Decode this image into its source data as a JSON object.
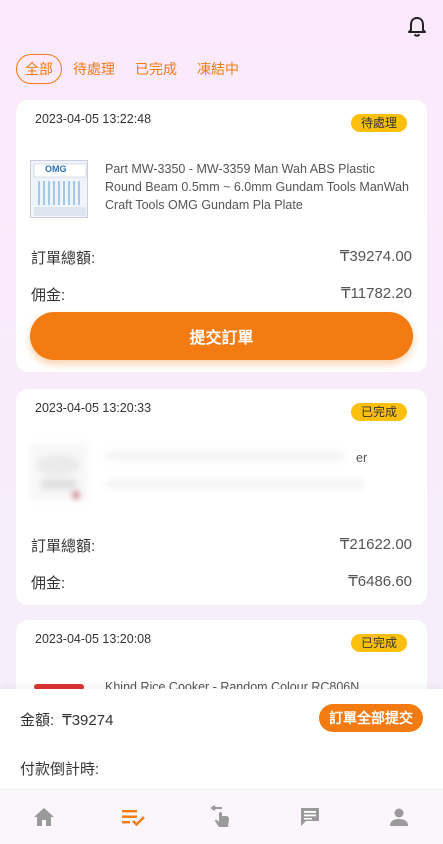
{
  "header": {
    "bell_icon": "bell-icon"
  },
  "tabs": [
    {
      "label": "全部",
      "active": true
    },
    {
      "label": "待處理",
      "active": false
    },
    {
      "label": "已完成",
      "active": false
    },
    {
      "label": "凍結中",
      "active": false
    }
  ],
  "orders": [
    {
      "date": "2023-04-05 13:22:48",
      "status": "待處理",
      "product": "Part MW-3350 - MW-3359 Man Wah ABS Plastic Round Beam 0.5mm ~ 6.0mm Gundam Tools ManWah Craft Tools OMG Gundam Pla Plate",
      "thumb_brand": "OMG",
      "total_label": "訂單總額:",
      "total": "₸39274.00",
      "commission_label": "佣金:",
      "commission": "₸11782.20",
      "submit_label": "提交訂單"
    },
    {
      "date": "2023-04-05 13:20:33",
      "status": "已完成",
      "product": "er",
      "total_label": "訂單總額:",
      "total": "₸21622.00",
      "commission_label": "佣金:",
      "commission": "₸6486.60"
    },
    {
      "date": "2023-04-05 13:20:08",
      "status": "已完成",
      "product": "Khind Rice Cooker - Random Colour RC806N"
    }
  ],
  "summary": {
    "amount_label": "金額:",
    "amount": "₸39274",
    "submit_all_label": "訂單全部提交",
    "countdown_label": "付款倒計時:"
  },
  "nav": [
    {
      "icon": "home-icon",
      "active": false
    },
    {
      "icon": "order-list-icon",
      "active": true
    },
    {
      "icon": "tap-icon",
      "active": false
    },
    {
      "icon": "message-icon",
      "active": false
    },
    {
      "icon": "user-icon",
      "active": false
    }
  ],
  "colors": {
    "accent": "#f47a12",
    "badge": "#fbbf0e",
    "nav_inactive": "#9a9a9a"
  }
}
